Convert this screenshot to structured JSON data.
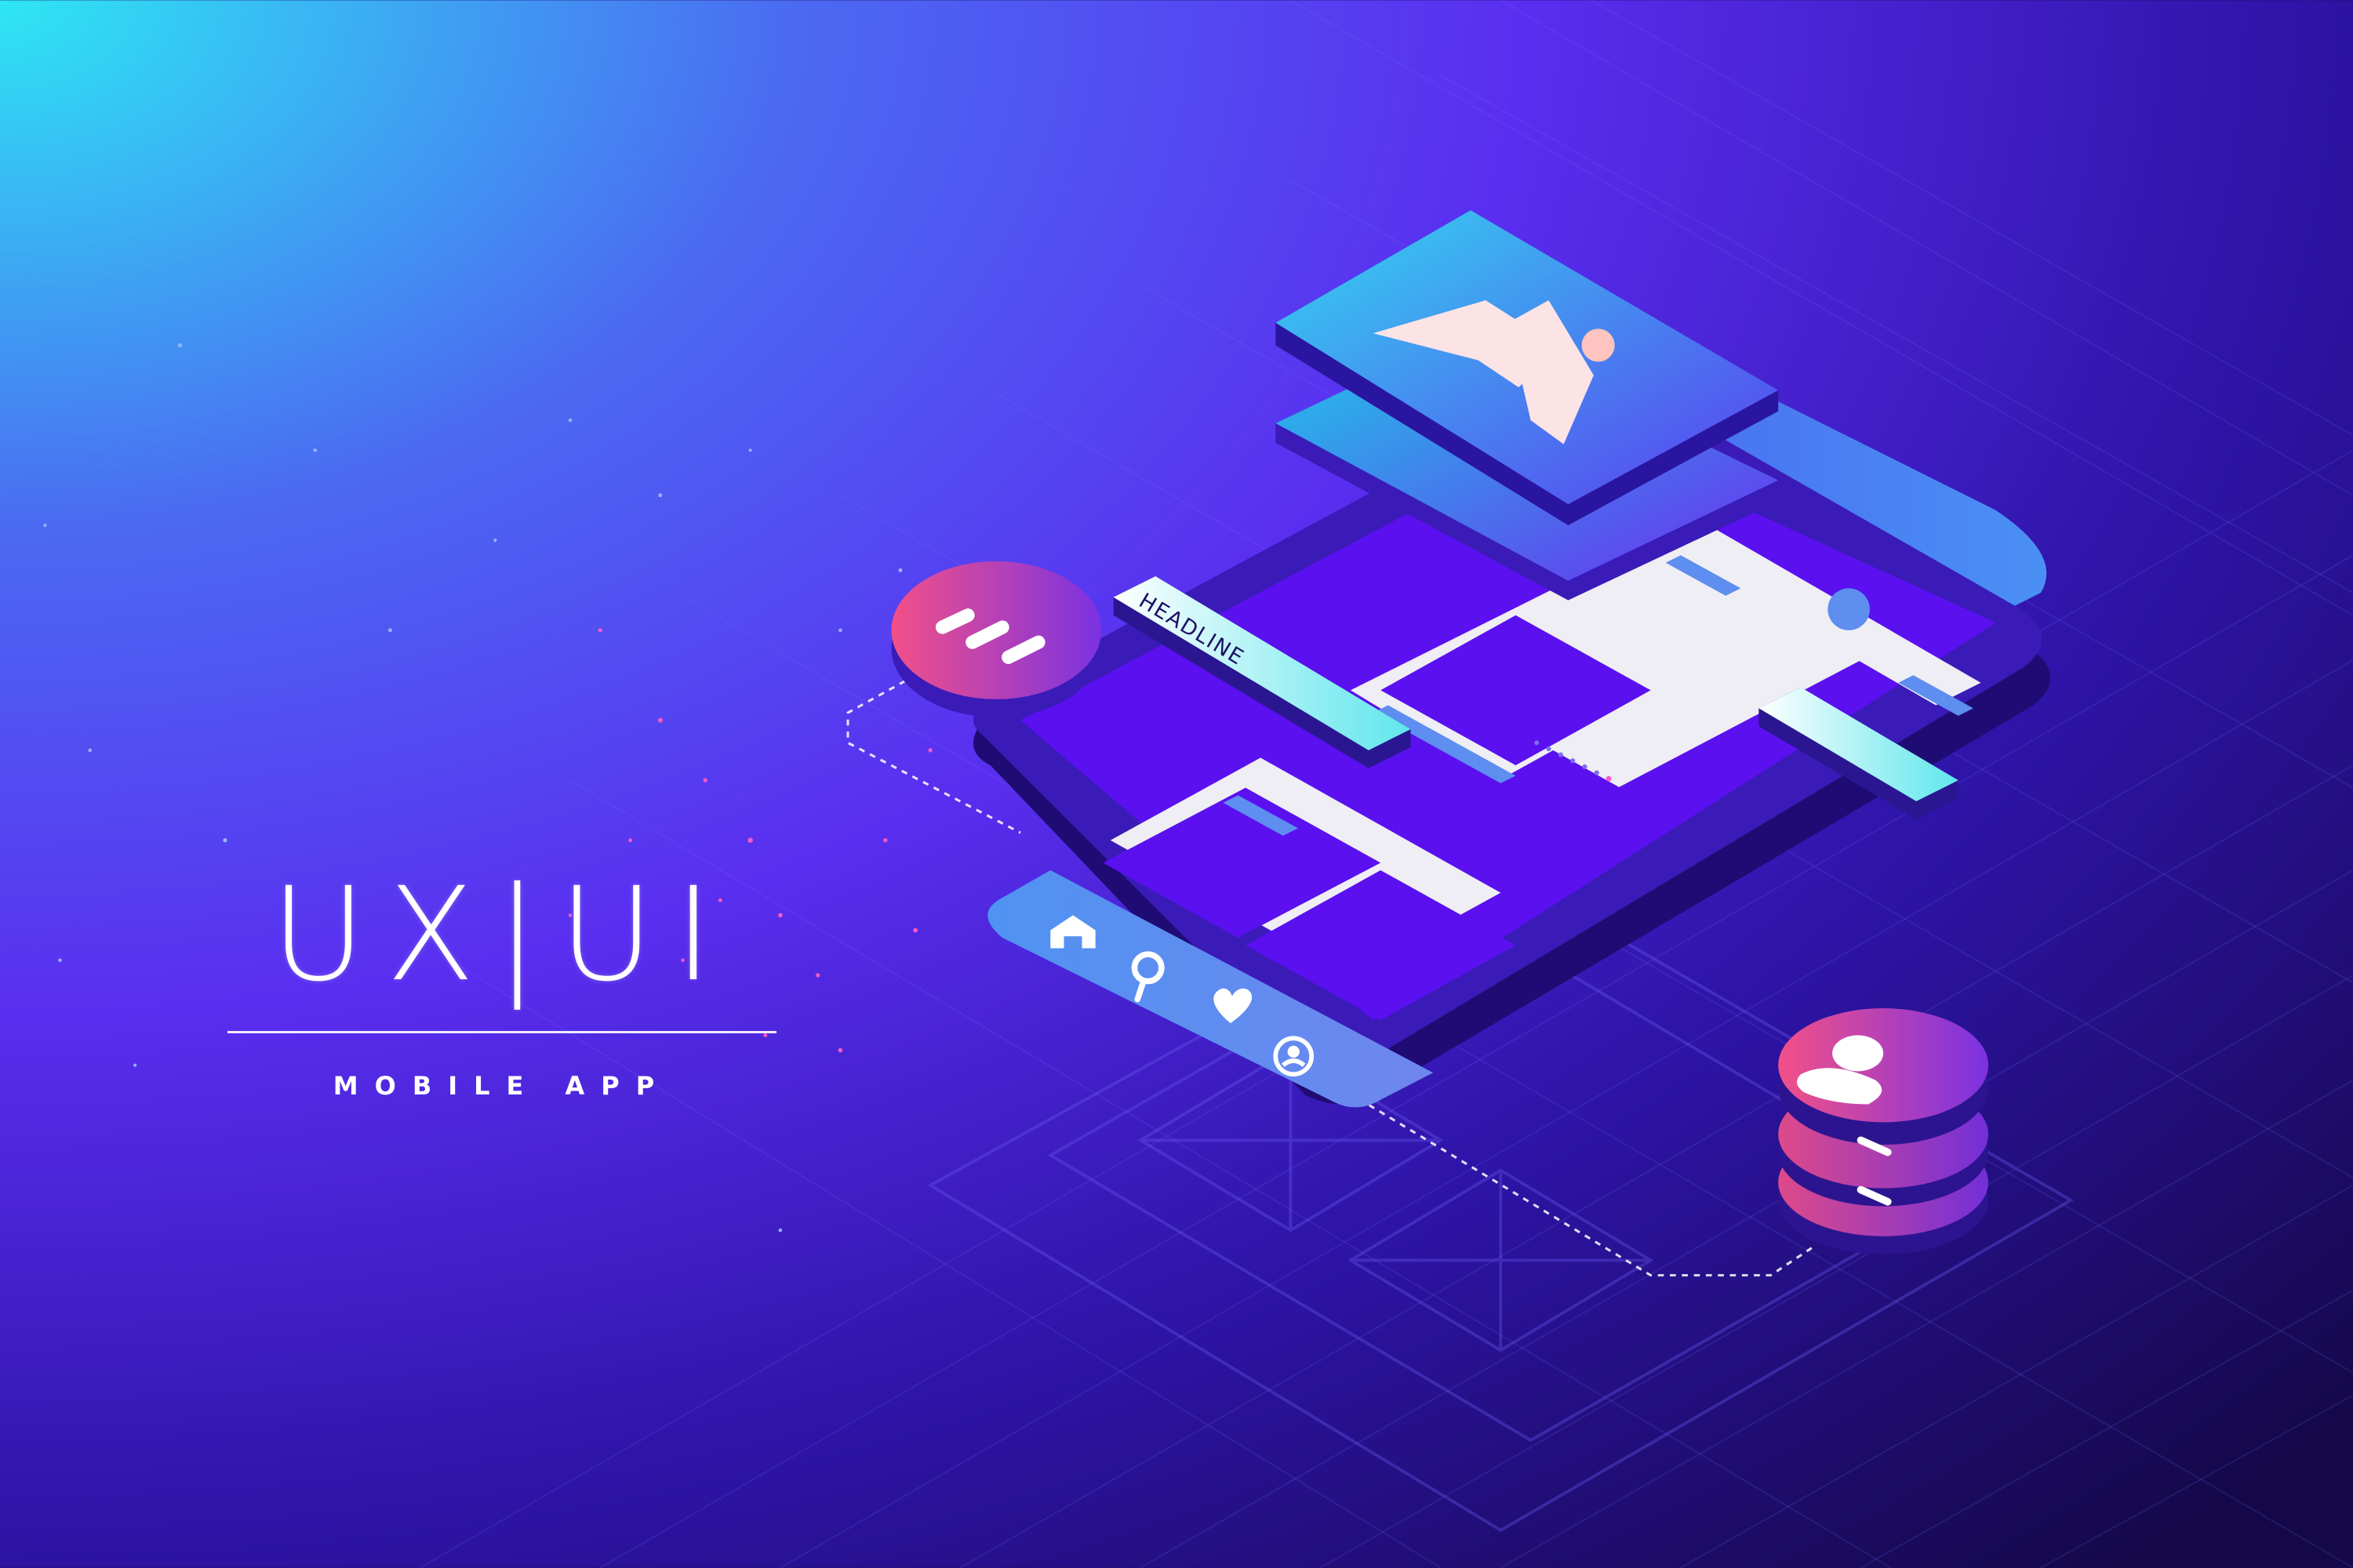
{
  "title": "UX|UI",
  "subtitle": "MOBILE APP",
  "headline_label": "HEADLINE",
  "colors": {
    "bg_cyan": "#22d3f0",
    "bg_blue": "#5a3cf5",
    "bg_deep": "#1a0b60",
    "phone_body": "#3a1bb8",
    "screen_block": "#5b10f0",
    "screen_panel": "#eeeef4",
    "accent_blue": "#5d8ef0",
    "badge_pink": "#f0508c",
    "badge_violet": "#7c34e0",
    "label_cyan": "#5fe6ec"
  },
  "nav_icons": [
    "home-icon",
    "search-icon",
    "heart-icon",
    "profile-icon"
  ],
  "floating_icons": [
    "image-icon",
    "menu-lines-icon",
    "user-icon"
  ]
}
